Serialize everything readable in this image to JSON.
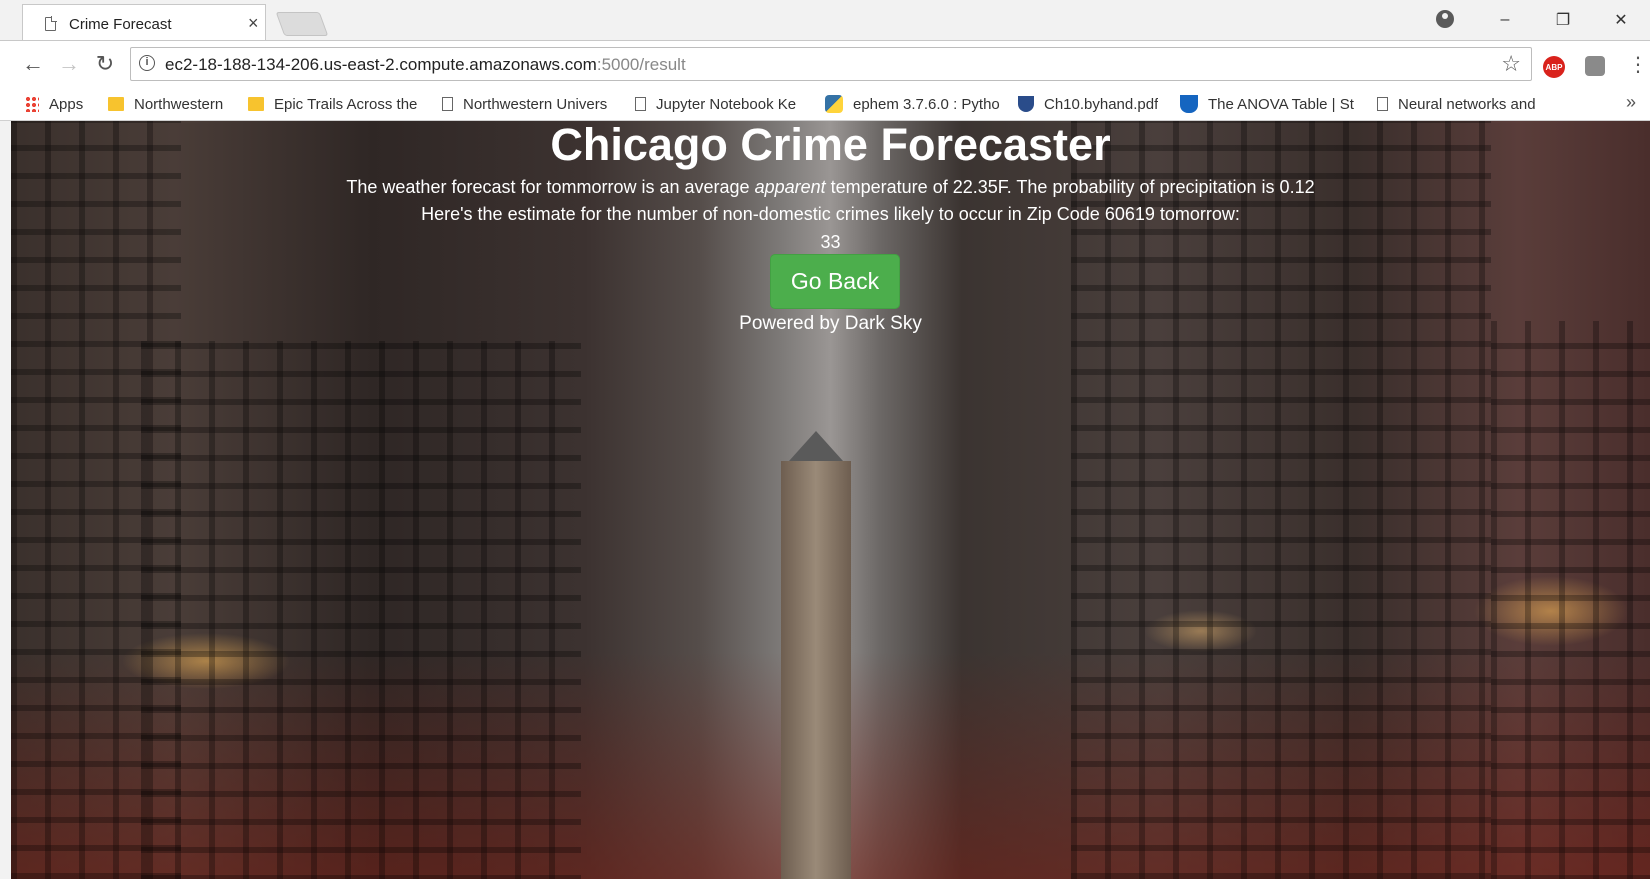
{
  "browser": {
    "tab_title": "Crime Forecast",
    "tab_close": "×",
    "url_host": "ec2-18-188-134-206.us-east-2.compute.amazonaws.com",
    "url_path": ":5000/result",
    "window_controls": {
      "minimize": "–",
      "restore": "❐",
      "close": "✕"
    },
    "abp_label": "ABP",
    "bookmarks": [
      {
        "label": "Apps",
        "icon": "apps-grid-icon"
      },
      {
        "label": "Northwestern",
        "icon": "folder-icon"
      },
      {
        "label": "Epic Trails Across the",
        "icon": "folder-icon"
      },
      {
        "label": "Northwestern Univers",
        "icon": "page-icon"
      },
      {
        "label": "Jupyter Notebook Ke",
        "icon": "page-icon"
      },
      {
        "label": "ephem 3.7.6.0 : Pytho",
        "icon": "python-icon"
      },
      {
        "label": "Ch10.byhand.pdf",
        "icon": "shield-icon"
      },
      {
        "label": "The ANOVA Table | St",
        "icon": "shield-icon"
      },
      {
        "label": "Neural networks and",
        "icon": "page-icon"
      }
    ],
    "bookmarks_more": "»"
  },
  "page": {
    "title": "Chicago Crime Forecaster",
    "weather_prefix": "The weather forecast for tommorrow is an average ",
    "weather_emph": "apparent",
    "weather_suffix": " temperature of 22.35F. The probability of precipitation is 0.12",
    "estimate_text": "Here's the estimate for the number of non-domestic crimes likely to occur in Zip Code 60619 tomorrow:",
    "crime_count": "33",
    "go_back_label": "Go Back",
    "powered_by": "Powered by Dark Sky"
  }
}
